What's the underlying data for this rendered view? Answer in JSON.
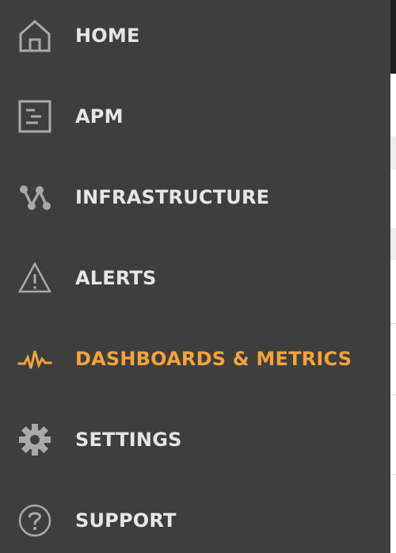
{
  "nav": {
    "items": [
      {
        "label": "HOME",
        "icon": "home-icon",
        "active": false
      },
      {
        "label": "APM",
        "icon": "apm-icon",
        "active": false
      },
      {
        "label": "INFRASTRUCTURE",
        "icon": "infrastructure-icon",
        "active": false
      },
      {
        "label": "ALERTS",
        "icon": "alert-triangle-icon",
        "active": false
      },
      {
        "label": "DASHBOARDS & METRICS",
        "icon": "pulse-icon",
        "active": true
      },
      {
        "label": "SETTINGS",
        "icon": "gear-icon",
        "active": false
      },
      {
        "label": "SUPPORT",
        "icon": "question-circle-icon",
        "active": false
      }
    ]
  },
  "colors": {
    "sidebar_bg": "#3e3e3e",
    "text": "#e6e6e6",
    "icon": "#a9a9a9",
    "active": "#f5a33a"
  }
}
